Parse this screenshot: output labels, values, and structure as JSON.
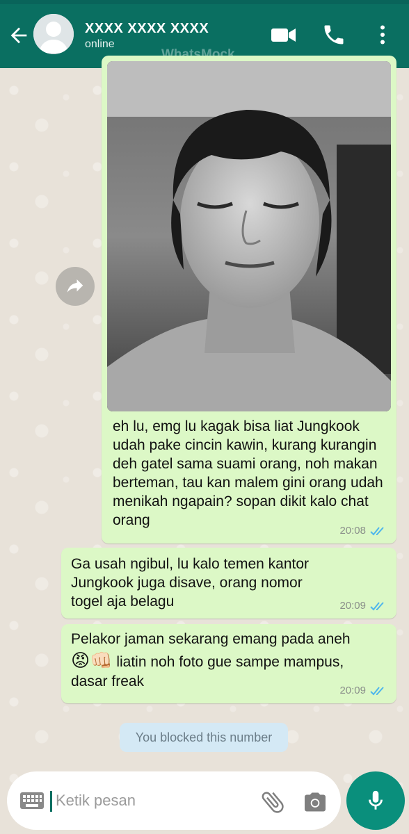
{
  "header": {
    "contact_name": "XXXX XXXX XXXX",
    "status": "online",
    "watermark": "WhatsMock",
    "icons": [
      "back-arrow-icon",
      "video-call-icon",
      "phone-icon",
      "more-vert-icon"
    ]
  },
  "messages": [
    {
      "type": "image_with_caption",
      "caption": "eh lu, emg lu kagak bisa liat Jungkook udah pake cincin kawin, kurang kurangin deh gatel sama suami orang, noh makan berteman, tau kan malem gini orang udah menikah ngapain? sopan dikit kalo chat orang",
      "time": "20:08",
      "ticks": "read"
    },
    {
      "type": "text",
      "text": "Ga usah ngibul, lu kalo temen kantor Jungkook juga disave, orang nomor togel aja belagu",
      "time": "20:09",
      "ticks": "read"
    },
    {
      "type": "text",
      "text_line1": "Pelakor jaman sekarang emang pada aneh",
      "emoji_1": "😡",
      "emoji_2": "👊🏻",
      "text_line2": " liatin noh foto gue sampe mampus,",
      "text_line3": "dasar freak",
      "time": "20:09",
      "ticks": "read"
    }
  ],
  "system_notice": "You blocked this number",
  "composer": {
    "placeholder": "Ketik pesan",
    "value": ""
  },
  "colors": {
    "header": "#0a6f61",
    "bubble_out": "#dcf8c6",
    "read_ticks": "#4fb6ec",
    "mic_button": "#0a8f7c"
  }
}
